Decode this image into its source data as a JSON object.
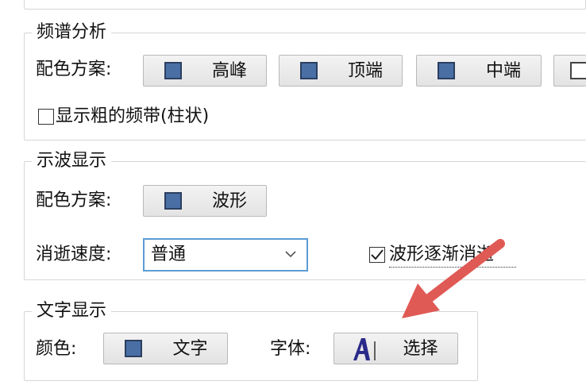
{
  "spectrum": {
    "legend": "频谱分析",
    "color_scheme_label": "配色方案:",
    "buttons": [
      "高峰",
      "顶端",
      "中端"
    ],
    "thick_band_checkbox": {
      "label": "显示粗的频带(柱状)",
      "checked": false
    }
  },
  "oscilloscope": {
    "legend": "示波显示",
    "color_scheme_label": "配色方案:",
    "waveform_button": "波形",
    "fade_speed_label": "消逝速度:",
    "fade_speed_value": "普通",
    "fade_checkbox": {
      "label": "波形逐渐消逝",
      "checked": true
    }
  },
  "text_display": {
    "legend": "文字显示",
    "color_label": "颜色:",
    "color_button": "文字",
    "font_label": "字体:",
    "font_button": "选择"
  },
  "colors": {
    "swatch": "#4a6fa5",
    "annotation_arrow": "#e05a55",
    "focus_border": "#5b9bd5"
  }
}
